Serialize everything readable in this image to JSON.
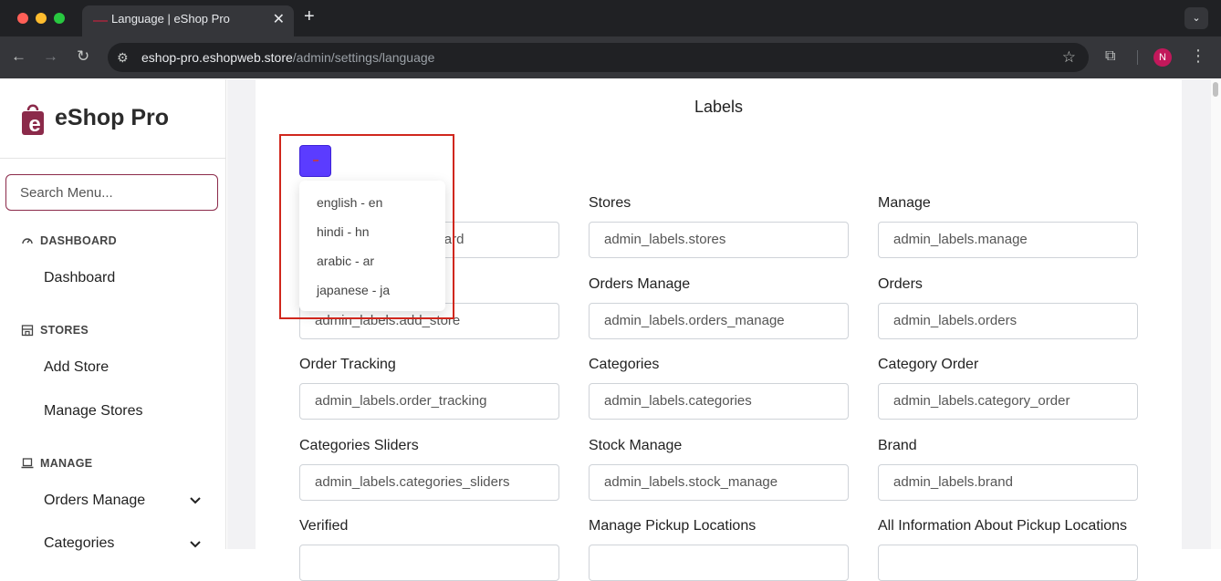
{
  "browser": {
    "tab_title": "Language | eShop Pro",
    "tab_close": "✕",
    "new_tab": "+",
    "url_host": "eshop-pro.eshopwebstore",
    "url_host_display": "eshop-pro.eshopweb.store",
    "url_path": "/admin/settings/language",
    "profile_initial": "N"
  },
  "sidebar": {
    "brand": "eShop Pro",
    "search_placeholder": "Search Menu...",
    "sections": [
      {
        "heading": "DASHBOARD",
        "items": [
          "Dashboard"
        ]
      },
      {
        "heading": "STORES",
        "items": [
          "Add Store",
          "Manage Stores"
        ]
      },
      {
        "heading": "MANAGE",
        "items": [
          "Orders Manage",
          "Categories"
        ]
      }
    ]
  },
  "main": {
    "title": "Labels",
    "language_dropdown": {
      "options": [
        "english - en",
        "hindi - hn",
        "arabic - ar",
        "japanese - ja"
      ]
    },
    "fields": [
      {
        "label": "",
        "value": "admin_labels.dashboard"
      },
      {
        "label": "Stores",
        "value": "admin_labels.stores"
      },
      {
        "label": "Manage",
        "value": "admin_labels.manage"
      },
      {
        "label": "",
        "value": "admin_labels.add_store"
      },
      {
        "label": "Orders Manage",
        "value": "admin_labels.orders_manage"
      },
      {
        "label": "Orders",
        "value": "admin_labels.orders"
      },
      {
        "label": "Order Tracking",
        "value": "admin_labels.order_tracking"
      },
      {
        "label": "Categories",
        "value": "admin_labels.categories"
      },
      {
        "label": "Category Order",
        "value": "admin_labels.category_order"
      },
      {
        "label": "Categories Sliders",
        "value": "admin_labels.categories_sliders"
      },
      {
        "label": "Stock Manage",
        "value": "admin_labels.stock_manage"
      },
      {
        "label": "Brand",
        "value": "admin_labels.brand"
      },
      {
        "label": "Verified",
        "value": ""
      },
      {
        "label": "Manage Pickup Locations",
        "value": ""
      },
      {
        "label": "All Information About Pickup Locations",
        "value": ""
      }
    ]
  },
  "colors": {
    "brand": "#8b2a4a",
    "button": "#5b3cff",
    "highlight": "#d0271d"
  }
}
